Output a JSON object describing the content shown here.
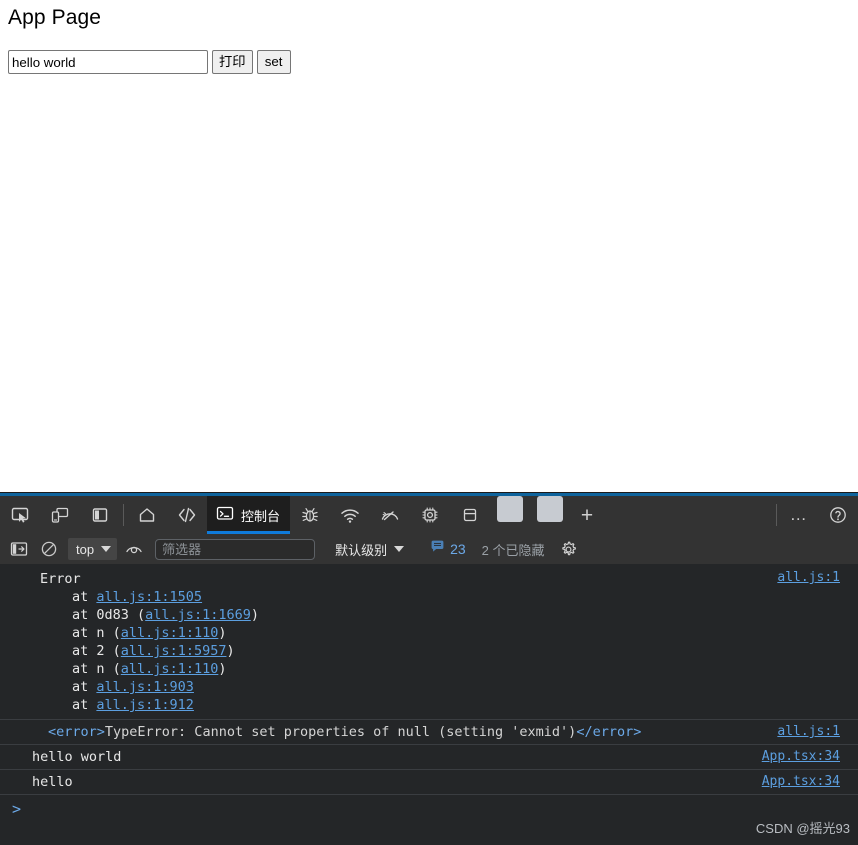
{
  "page": {
    "title": "App Page",
    "input_value": "hello world",
    "input_placeholder": "",
    "print_button": "打印",
    "set_button": "set"
  },
  "devtools": {
    "tabs": [
      {
        "label": "",
        "icon": "inspect-element-icon",
        "active": false
      },
      {
        "label": "",
        "icon": "device-toolbar-icon",
        "active": false
      },
      {
        "label": "",
        "icon": "dock-panel-icon",
        "active": false
      },
      {
        "label": "",
        "icon": "home-icon",
        "active": false
      },
      {
        "label": "",
        "icon": "elements-code-icon",
        "active": false
      },
      {
        "label": "控制台",
        "icon": "console-icon",
        "active": true
      },
      {
        "label": "",
        "icon": "bug-icon",
        "active": false
      },
      {
        "label": "",
        "icon": "network-wifi-icon",
        "active": false
      },
      {
        "label": "",
        "icon": "performance-gauge-icon",
        "active": false
      },
      {
        "label": "",
        "icon": "memory-chip-icon",
        "active": false
      },
      {
        "label": "",
        "icon": "application-storage-icon",
        "active": false
      }
    ],
    "add_tab_label": "+",
    "more_label": "…",
    "filterbar": {
      "context": "top",
      "filter_placeholder": "筛选器",
      "filter_value": "",
      "level": "默认级别",
      "message_count": "23",
      "hidden_note": "2 个已隐藏"
    },
    "console": {
      "messages": [
        {
          "type": "error-group",
          "title": "Error",
          "source": "all.js:1",
          "stack": [
            {
              "prefix": "at ",
              "fn": "",
              "link": "all.js:1:1505",
              "paren": false
            },
            {
              "prefix": "at ",
              "fn": "0d83 ",
              "link": "all.js:1:1669",
              "paren": true
            },
            {
              "prefix": "at ",
              "fn": "n ",
              "link": "all.js:1:110",
              "paren": true
            },
            {
              "prefix": "at ",
              "fn": "2 ",
              "link": "all.js:1:5957",
              "paren": true
            },
            {
              "prefix": "at ",
              "fn": "n ",
              "link": "all.js:1:110",
              "paren": true
            },
            {
              "prefix": "at ",
              "fn": "",
              "link": "all.js:1:903",
              "paren": false
            },
            {
              "prefix": "at ",
              "fn": "",
              "link": "all.js:1:912",
              "paren": false
            }
          ]
        },
        {
          "type": "xml",
          "open_tag": "<error>",
          "text": "TypeError: Cannot set properties of null (setting 'exmid')",
          "close_tag": "</error>",
          "source": "all.js:1"
        },
        {
          "type": "log",
          "text": "hello world",
          "source": "App.tsx:34"
        },
        {
          "type": "log",
          "text": "hello",
          "source": "App.tsx:34"
        }
      ],
      "prompt": ">",
      "watermark": "CSDN @摇光93"
    }
  },
  "colors": {
    "accent_blue": "#0f7bdb",
    "link_blue": "#5c9fe0",
    "console_bg": "#242628",
    "toolbar_bg": "#333333",
    "active_tab_bg": "#1e1e1e"
  }
}
